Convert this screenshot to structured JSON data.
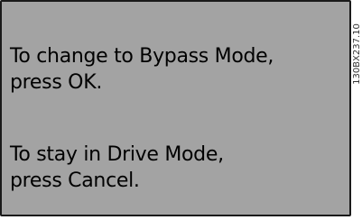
{
  "display": {
    "bypass_prompt": {
      "line1": "To change to Bypass Mode,",
      "line2": "press OK."
    },
    "drive_prompt": {
      "line1": "To stay in Drive Mode,",
      "line2": "press Cancel."
    },
    "background_color": "#a3a3a3",
    "border_color": "#1a1a1a"
  },
  "figure_ref": "130BX237.10"
}
